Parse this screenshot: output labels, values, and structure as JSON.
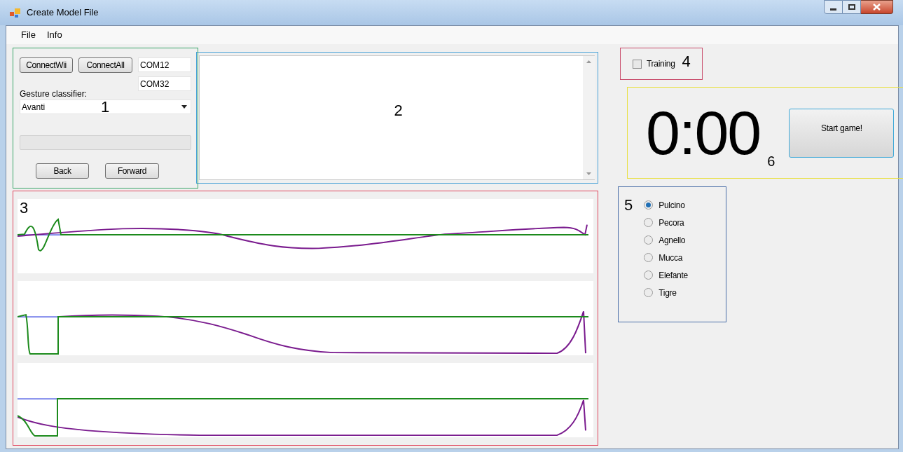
{
  "window": {
    "title": "Create Model File"
  },
  "menu": [
    {
      "label": "File"
    },
    {
      "label": "Info"
    }
  ],
  "connection_panel": {
    "annotation": "1",
    "buttons": [
      "ConnectWii",
      "ConnectAll"
    ],
    "ports": [
      "COM12",
      "COM32"
    ],
    "classifier_label": "Gesture classifier:",
    "classifier_value": "Avanti",
    "nav_buttons": [
      "Back",
      "Forward"
    ]
  },
  "log_panel": {
    "annotation": "2"
  },
  "graph_panel": {
    "annotation": "3"
  },
  "training": {
    "label": "Training",
    "checked": false,
    "annotation": "4"
  },
  "timer": {
    "time": "0:00",
    "annotation": "6",
    "button": "Start game!"
  },
  "animals": {
    "annotation": "5",
    "options": [
      {
        "label": "Pulcino",
        "selected": true
      },
      {
        "label": "Pecora",
        "selected": false
      },
      {
        "label": "Agnello",
        "selected": false
      },
      {
        "label": "Mucca",
        "selected": false
      },
      {
        "label": "Elefante",
        "selected": false
      },
      {
        "label": "Tigre",
        "selected": false
      }
    ]
  }
}
